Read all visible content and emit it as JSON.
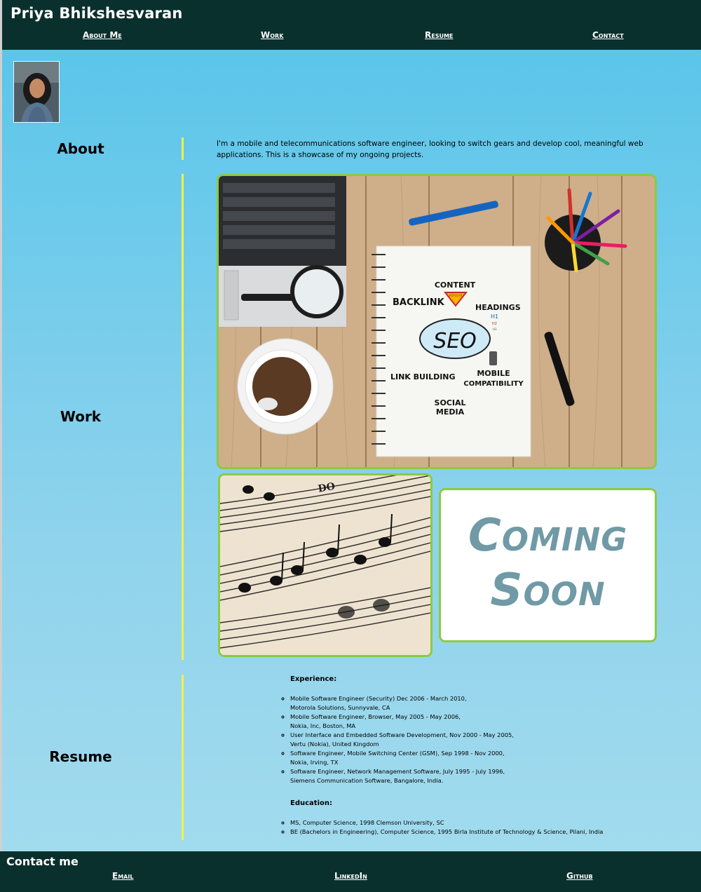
{
  "header": {
    "title": "Priya Bhikshesvaran"
  },
  "nav": [
    {
      "label": "About Me"
    },
    {
      "label": "Work"
    },
    {
      "label": "Resume"
    },
    {
      "label": "Contact"
    }
  ],
  "about": {
    "heading": "About",
    "text": "I'm a mobile and telecommunications software engineer, looking to switch gears and develop cool, meaningful web applications. This is a showcase of my ongoing projects."
  },
  "work": {
    "heading": "Work",
    "seo": {
      "backlink": "BACKLINK",
      "content": "CONTENT",
      "popular": "POPULAR",
      "headings": "HEADINGS",
      "h1": "H1",
      "h2": "H2",
      "h3": "H3",
      "seo": "SEO",
      "link_building": "LINK BUILDING",
      "mobile": "MOBILE",
      "compatibility": "COMPATIBILITY",
      "social": "SOCIAL",
      "media": "MEDIA"
    },
    "music": {
      "do": "DO"
    },
    "coming_soon": {
      "line1": "Coming",
      "line2": "Soon"
    }
  },
  "resume": {
    "heading": "Resume",
    "experience_heading": "Experience:",
    "experience": [
      {
        "line1": "Mobile Software Engineer (Security) Dec 2006 - March 2010,",
        "line2": "Motorola Solutions, Sunnyvale, CA"
      },
      {
        "line1": "Mobile Software Engineer, Browser, May 2005 - May 2006,",
        "line2": "Nokia, Inc, Boston, MA"
      },
      {
        "line1": "User Interface and Embedded Software Development, Nov 2000 - May 2005,",
        "line2": "Vertu (Nokia), United Kingdom"
      },
      {
        "line1": "Software Engineer, Mobile Switching Center (GSM), Sep 1998 - Nov 2000,",
        "line2": "Nokia, Irving, TX"
      },
      {
        "line1": "Software Engineer, Network Management Software, July 1995 - July 1996,",
        "line2": "Siemens Communication Software, Bangalore, India."
      }
    ],
    "education_heading": "Education:",
    "education": [
      "MS, Computer Science, 1998 Clemson University, SC",
      "BE (Bachelors in Engineering), Computer Science, 1995 Birla Institute of Technology & Science, Pilani, India"
    ]
  },
  "footer": {
    "title": "Contact me",
    "links": [
      {
        "label": "Email"
      },
      {
        "label": "LinkedIn"
      },
      {
        "label": "Github"
      }
    ]
  }
}
